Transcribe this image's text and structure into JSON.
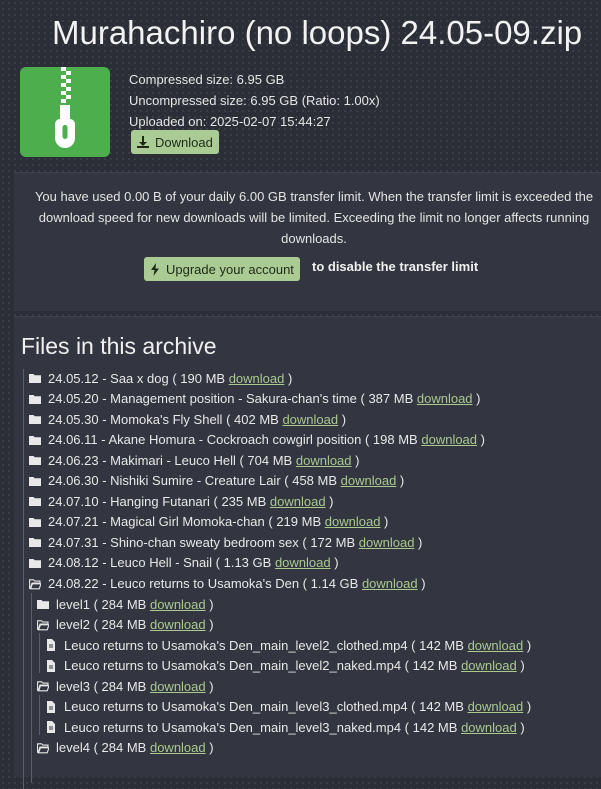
{
  "title": "Murahachiro (no loops) 24.05-09.zip",
  "file_icon": "zip-file-icon",
  "meta": {
    "compressed": "Compressed size: 6.95 GB",
    "uncompressed": "Uncompressed size: 6.95 GB (Ratio: 1.00x)",
    "uploaded": "Uploaded on: 2025-02-07 15:44:27",
    "download_label": "Download"
  },
  "limit": {
    "line1": "You have used 0.00 B of your daily 6.00 GB transfer limit. When the transfer limit is exceeded the",
    "line2": "download speed for new downloads will be limited. Exceeding the limit no longer affects running",
    "line3": "downloads.",
    "upgrade_label": "Upgrade your account",
    "upgrade_tail": "to disable the transfer limit"
  },
  "files": {
    "heading": "Files in this archive",
    "link_label": "download",
    "items": [
      {
        "type": "folder",
        "open": false,
        "depth": 0,
        "name": "24.05.12 - Saa x dog",
        "size": "190 MB"
      },
      {
        "type": "folder",
        "open": false,
        "depth": 0,
        "name": "24.05.20 - Management position - Sakura-chan's time",
        "size": "387 MB"
      },
      {
        "type": "folder",
        "open": false,
        "depth": 0,
        "name": "24.05.30 - Momoka's Fly Shell",
        "size": "402 MB"
      },
      {
        "type": "folder",
        "open": false,
        "depth": 0,
        "name": "24.06.11 - Akane Homura - Cockroach cowgirl position",
        "size": "198 MB"
      },
      {
        "type": "folder",
        "open": false,
        "depth": 0,
        "name": "24.06.23 - Makimari - Leuco Hell",
        "size": "704 MB"
      },
      {
        "type": "folder",
        "open": false,
        "depth": 0,
        "name": "24.06.30 - Nishiki Sumire - Creature Lair",
        "size": "458 MB"
      },
      {
        "type": "folder",
        "open": false,
        "depth": 0,
        "name": "24.07.10 - Hanging Futanari",
        "size": "235 MB"
      },
      {
        "type": "folder",
        "open": false,
        "depth": 0,
        "name": "24.07.21 - Magical Girl Momoka-chan",
        "size": "219 MB"
      },
      {
        "type": "folder",
        "open": false,
        "depth": 0,
        "name": "24.07.31 - Shino-chan sweaty bedroom sex",
        "size": "172 MB"
      },
      {
        "type": "folder",
        "open": false,
        "depth": 0,
        "name": "24.08.12 - Leuco Hell - Snail",
        "size": "1.13 GB"
      },
      {
        "type": "folder",
        "open": true,
        "depth": 0,
        "name": "24.08.22 - Leuco returns to Usamoka's Den",
        "size": "1.14 GB"
      },
      {
        "type": "folder",
        "open": false,
        "depth": 1,
        "name": "level1",
        "size": "284 MB"
      },
      {
        "type": "folder",
        "open": true,
        "depth": 1,
        "name": "level2",
        "size": "284 MB"
      },
      {
        "type": "file",
        "depth": 2,
        "name": "Leuco returns to Usamoka's Den_main_level2_clothed.mp4",
        "size": "142 MB"
      },
      {
        "type": "file",
        "depth": 2,
        "name": "Leuco returns to Usamoka's Den_main_level2_naked.mp4",
        "size": "142 MB"
      },
      {
        "type": "folder",
        "open": true,
        "depth": 1,
        "name": "level3",
        "size": "284 MB"
      },
      {
        "type": "file",
        "depth": 2,
        "name": "Leuco returns to Usamoka's Den_main_level3_clothed.mp4",
        "size": "142 MB"
      },
      {
        "type": "file",
        "depth": 2,
        "name": "Leuco returns to Usamoka's Den_main_level3_naked.mp4",
        "size": "142 MB"
      },
      {
        "type": "folder",
        "open": true,
        "depth": 1,
        "name": "level4",
        "size": "284 MB"
      }
    ]
  },
  "colors": {
    "accent": "#aacc94",
    "link": "#a9c98f",
    "zip_green": "#4cae4c"
  }
}
